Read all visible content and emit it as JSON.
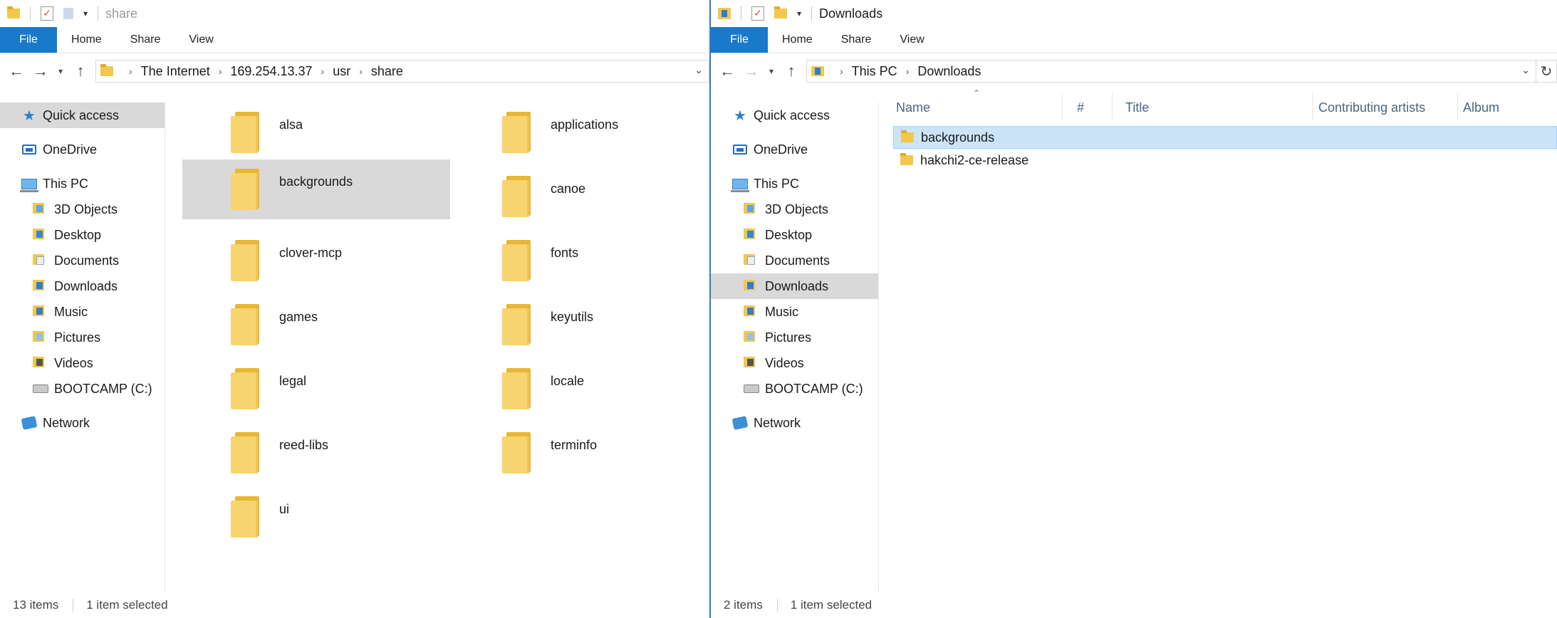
{
  "left": {
    "title": "share",
    "ribbon_tabs": [
      "File",
      "Home",
      "Share",
      "View"
    ],
    "breadcrumb": [
      "The Internet",
      "169.254.13.37",
      "usr",
      "share"
    ],
    "nav": {
      "quick_access": "Quick access",
      "onedrive": "OneDrive",
      "this_pc": "This PC",
      "children": [
        "3D Objects",
        "Desktop",
        "Documents",
        "Downloads",
        "Music",
        "Pictures",
        "Videos",
        "BOOTCAMP (C:)"
      ],
      "network": "Network"
    },
    "items": [
      "alsa",
      "applications",
      "backgrounds",
      "canoe",
      "clover-mcp",
      "fonts",
      "games",
      "keyutils",
      "legal",
      "locale",
      "reed-libs",
      "terminfo",
      "ui"
    ],
    "selected_item": "backgrounds",
    "status": {
      "count": "13 items",
      "selection": "1 item selected"
    }
  },
  "right": {
    "title": "Downloads",
    "ribbon_tabs": [
      "File",
      "Home",
      "Share",
      "View"
    ],
    "breadcrumb": [
      "This PC",
      "Downloads"
    ],
    "nav": {
      "quick_access": "Quick access",
      "onedrive": "OneDrive",
      "this_pc": "This PC",
      "children": [
        "3D Objects",
        "Desktop",
        "Documents",
        "Downloads",
        "Music",
        "Pictures",
        "Videos",
        "BOOTCAMP (C:)"
      ],
      "network": "Network"
    },
    "columns": [
      "Name",
      "#",
      "Title",
      "Contributing artists",
      "Album"
    ],
    "rows": [
      "backgrounds",
      "hakchi2-ce-release"
    ],
    "selected_item": "backgrounds",
    "status": {
      "count": "2 items",
      "selection": "1 item selected"
    }
  },
  "colors": {
    "accent": "#1979ca",
    "folder": "#f7d470",
    "selection": "#cce4f7",
    "hover_gray": "#d9d9d9"
  }
}
